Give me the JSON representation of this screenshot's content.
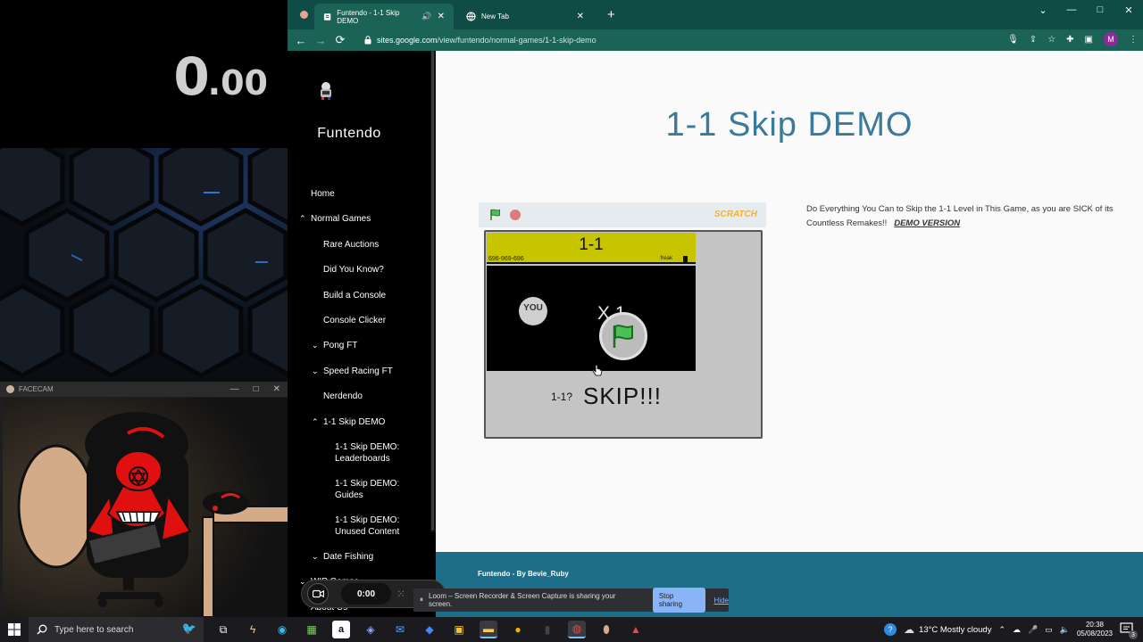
{
  "overlay": {
    "timer_big": "0",
    "timer_small": ".00",
    "facecam_title": "FACECAM",
    "facecam_controls": [
      "—",
      "□",
      "✕"
    ]
  },
  "browser": {
    "tabs": [
      {
        "label": "Funtendo - 1-1 Skip DEMO",
        "active": true
      },
      {
        "label": "New Tab",
        "active": false
      }
    ],
    "new_tab": "+",
    "window_controls": [
      "⌄",
      "—",
      "□",
      "✕"
    ],
    "url_domain": "sites.google.com",
    "url_path": "/view/funtendo/normal-games/1-1-skip-demo",
    "profile_initial": "M"
  },
  "site": {
    "name": "Funtendo",
    "nav": [
      {
        "label": "Home",
        "indent": 0,
        "chevron": false
      },
      {
        "label": "Normal Games",
        "indent": 0,
        "chevron": "up"
      },
      {
        "label": "Rare Auctions",
        "indent": 1,
        "chevron": false
      },
      {
        "label": "Did You Know?",
        "indent": 1,
        "chevron": false
      },
      {
        "label": "Build a Console",
        "indent": 1,
        "chevron": false
      },
      {
        "label": "Console Clicker",
        "indent": 1,
        "chevron": false
      },
      {
        "label": "Pong FT",
        "indent": 1,
        "chevron": "down"
      },
      {
        "label": "Speed Racing FT",
        "indent": 1,
        "chevron": "down"
      },
      {
        "label": "Nerdendo",
        "indent": 1,
        "chevron": false
      },
      {
        "label": "1-1 Skip DEMO",
        "indent": 1,
        "chevron": "up"
      },
      {
        "label": "1-1 Skip DEMO: Leaderboards",
        "indent": 2,
        "chevron": false
      },
      {
        "label": "1-1 Skip DEMO: Guides",
        "indent": 2,
        "chevron": false
      },
      {
        "label": "1-1 Skip DEMO: Unused Content",
        "indent": 2,
        "chevron": false
      },
      {
        "label": "Date Fishing",
        "indent": 1,
        "chevron": "down"
      },
      {
        "label": "WIP Games",
        "indent": 0,
        "chevron": "down"
      },
      {
        "label": "About Us",
        "indent": 0,
        "chevron": false
      }
    ],
    "page_title": "1-1 Skip DEMO",
    "description": "Do Everything You Can to Skip the 1-1 Level in This Game, as you are SICK of its Countless Remakes!!",
    "description_link": "DEMO VERSION",
    "footer": "Funtendo - By Bevie_Ruby"
  },
  "game": {
    "brand": "SCRATCH",
    "level_title": "1-1",
    "phone": "696-969-696",
    "freak": "freak",
    "you": "YOU",
    "multiplier": "X 1",
    "question": "1-1?",
    "skip": "SKIP!!!"
  },
  "loom": {
    "time": "0:00",
    "share_text": "Loom – Screen Recorder & Screen Capture is sharing your screen.",
    "stop_label": "Stop sharing",
    "hide_label": "Hide"
  },
  "taskbar": {
    "search_placeholder": "Type here to search",
    "weather": "13°C  Mostly cloudy",
    "time": "20:38",
    "date": "05/08/2023",
    "notification_count": "3"
  }
}
